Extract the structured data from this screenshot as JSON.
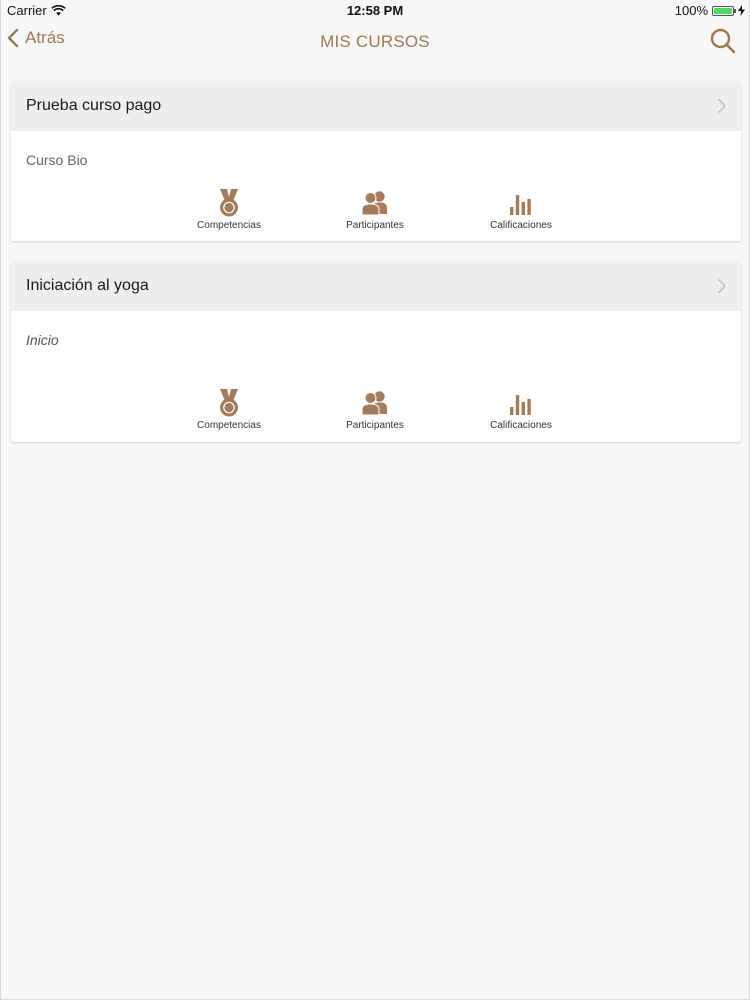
{
  "status_bar": {
    "carrier": "Carrier",
    "time": "12:58 PM",
    "battery": "100%",
    "battery_level": 1.0
  },
  "nav": {
    "back_label": "Atrás",
    "title": "MIS CURSOS"
  },
  "colors": {
    "accent": "#9a7a52",
    "header_bg": "#efeded",
    "page_bg": "#f8f7f7"
  },
  "courses": [
    {
      "title": "Prueba curso pago",
      "subtitle": "Curso Bio",
      "actions": [
        {
          "icon": "medal-icon",
          "label": "Competencias"
        },
        {
          "icon": "participants-icon",
          "label": "Participantes"
        },
        {
          "icon": "bar-chart-icon",
          "label": "Calificaciones"
        }
      ]
    },
    {
      "title": "Iniciación al yoga",
      "subtitle": "Inicio",
      "actions": [
        {
          "icon": "medal-icon",
          "label": "Competencias"
        },
        {
          "icon": "participants-icon",
          "label": "Participantes"
        },
        {
          "icon": "bar-chart-icon",
          "label": "Calificaciones"
        }
      ]
    }
  ]
}
